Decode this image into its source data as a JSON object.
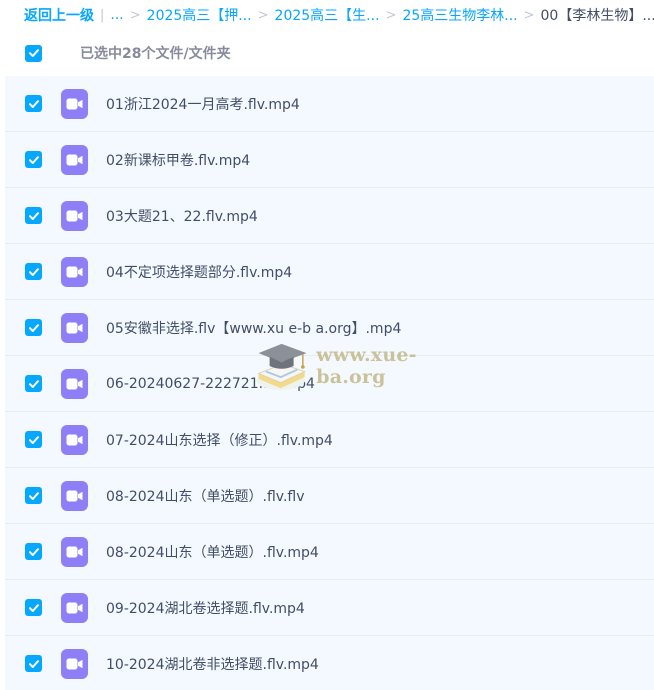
{
  "breadcrumb": {
    "back_label": "返回上一级",
    "divider": "|",
    "ellipsis": "...",
    "separator": ">",
    "items": [
      "2025高三【押...",
      "2025高三【生...",
      "25高三生物李林...",
      "00【李林生物】..."
    ]
  },
  "selection": {
    "checked": true,
    "label": "已选中28个文件/文件夹"
  },
  "files": [
    {
      "name": "01浙江2024一月高考.flv.mp4",
      "checked": true,
      "icon": "video-file-icon"
    },
    {
      "name": "02新课标甲卷.flv.mp4",
      "checked": true,
      "icon": "video-file-icon"
    },
    {
      "name": "03大题21、22.flv.mp4",
      "checked": true,
      "icon": "video-file-icon"
    },
    {
      "name": "04不定项选择题部分.flv.mp4",
      "checked": true,
      "icon": "video-file-icon"
    },
    {
      "name": "05安徽非选择.flv【www.xu e-b a.org】.mp4",
      "checked": true,
      "icon": "video-file-icon"
    },
    {
      "name": "06-20240627-222721.flv.mp4",
      "checked": true,
      "icon": "video-file-icon"
    },
    {
      "name": "07-2024山东选择（修正）.flv.mp4",
      "checked": true,
      "icon": "video-file-icon"
    },
    {
      "name": "08-2024山东（单选题）.flv.flv",
      "checked": true,
      "icon": "video-file-icon"
    },
    {
      "name": "08-2024山东（单选题）.flv.mp4",
      "checked": true,
      "icon": "video-file-icon"
    },
    {
      "name": "09-2024湖北卷选择题.flv.mp4",
      "checked": true,
      "icon": "video-file-icon"
    },
    {
      "name": "10-2024湖北卷非选择题.flv.mp4",
      "checked": true,
      "icon": "video-file-icon"
    }
  ],
  "watermark": {
    "text": "www.xue-ba.org",
    "icon": "graduation-cap-book-icon"
  },
  "colors": {
    "accent": "#06a7ff",
    "video_icon": "#8f7ff7",
    "row_background": "#f4f9ff",
    "text": "#424e67"
  }
}
